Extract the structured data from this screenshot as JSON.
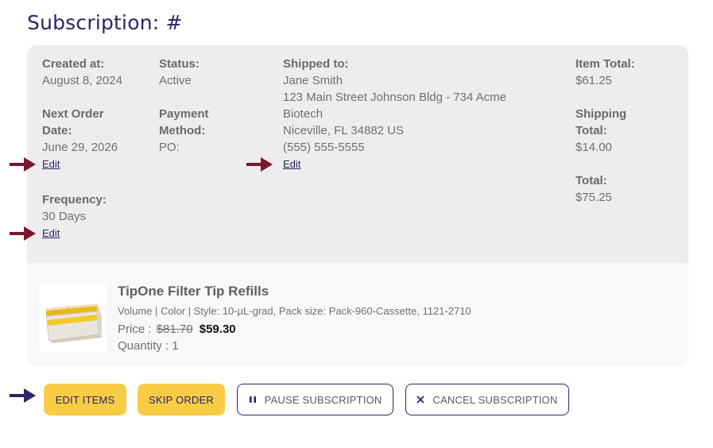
{
  "page": {
    "title": "Subscription: #"
  },
  "summary": {
    "created": {
      "label": "Created at:",
      "value": "August 8, 2024"
    },
    "next_order": {
      "label_line1": "Next Order",
      "label_line2": "Date:",
      "value": "June 29, 2026",
      "edit_label": "Edit"
    },
    "frequency": {
      "label": "Frequency:",
      "value": "30 Days",
      "edit_label": "Edit"
    },
    "status": {
      "label": "Status:",
      "value": "Active"
    },
    "payment": {
      "label_line1": "Payment",
      "label_line2": "Method:",
      "value": "PO:"
    },
    "shipping": {
      "label": "Shipped to:",
      "name": "Jane Smith",
      "address_line1": "123 Main Street Johnson Bldg - 734 Acme",
      "address_line2": "Biotech",
      "city_line": "Niceville, FL 34882 US",
      "phone": "(555) 555-5555",
      "edit_label": "Edit"
    },
    "totals": {
      "item_label": "Item Total:",
      "item_value": "$61.25",
      "shipping_label_line1": "Shipping",
      "shipping_label_line2": "Total:",
      "shipping_value": "$14.00",
      "total_label": "Total:",
      "total_value": "$75.25"
    }
  },
  "item": {
    "name": "TipOne Filter Tip Refills",
    "variant": "Volume | Color | Style: 10-µL-grad, Pack size: Pack-960-Cassette, 1121-2710",
    "price_label": "Price :",
    "old_price": "$81.70",
    "new_price": "$59.30",
    "quantity": "Quantity : 1"
  },
  "actions": {
    "edit_items": "EDIT ITEMS",
    "skip_order": "SKIP ORDER",
    "pause": "PAUSE SUBSCRIPTION",
    "cancel": "CANCEL SUBSCRIPTION"
  },
  "colors": {
    "brand_navy": "#2b2466",
    "accent_yellow": "#f9cc45",
    "annotation_arrow_red": "#7a1630",
    "annotation_arrow_navy": "#2b2466"
  }
}
